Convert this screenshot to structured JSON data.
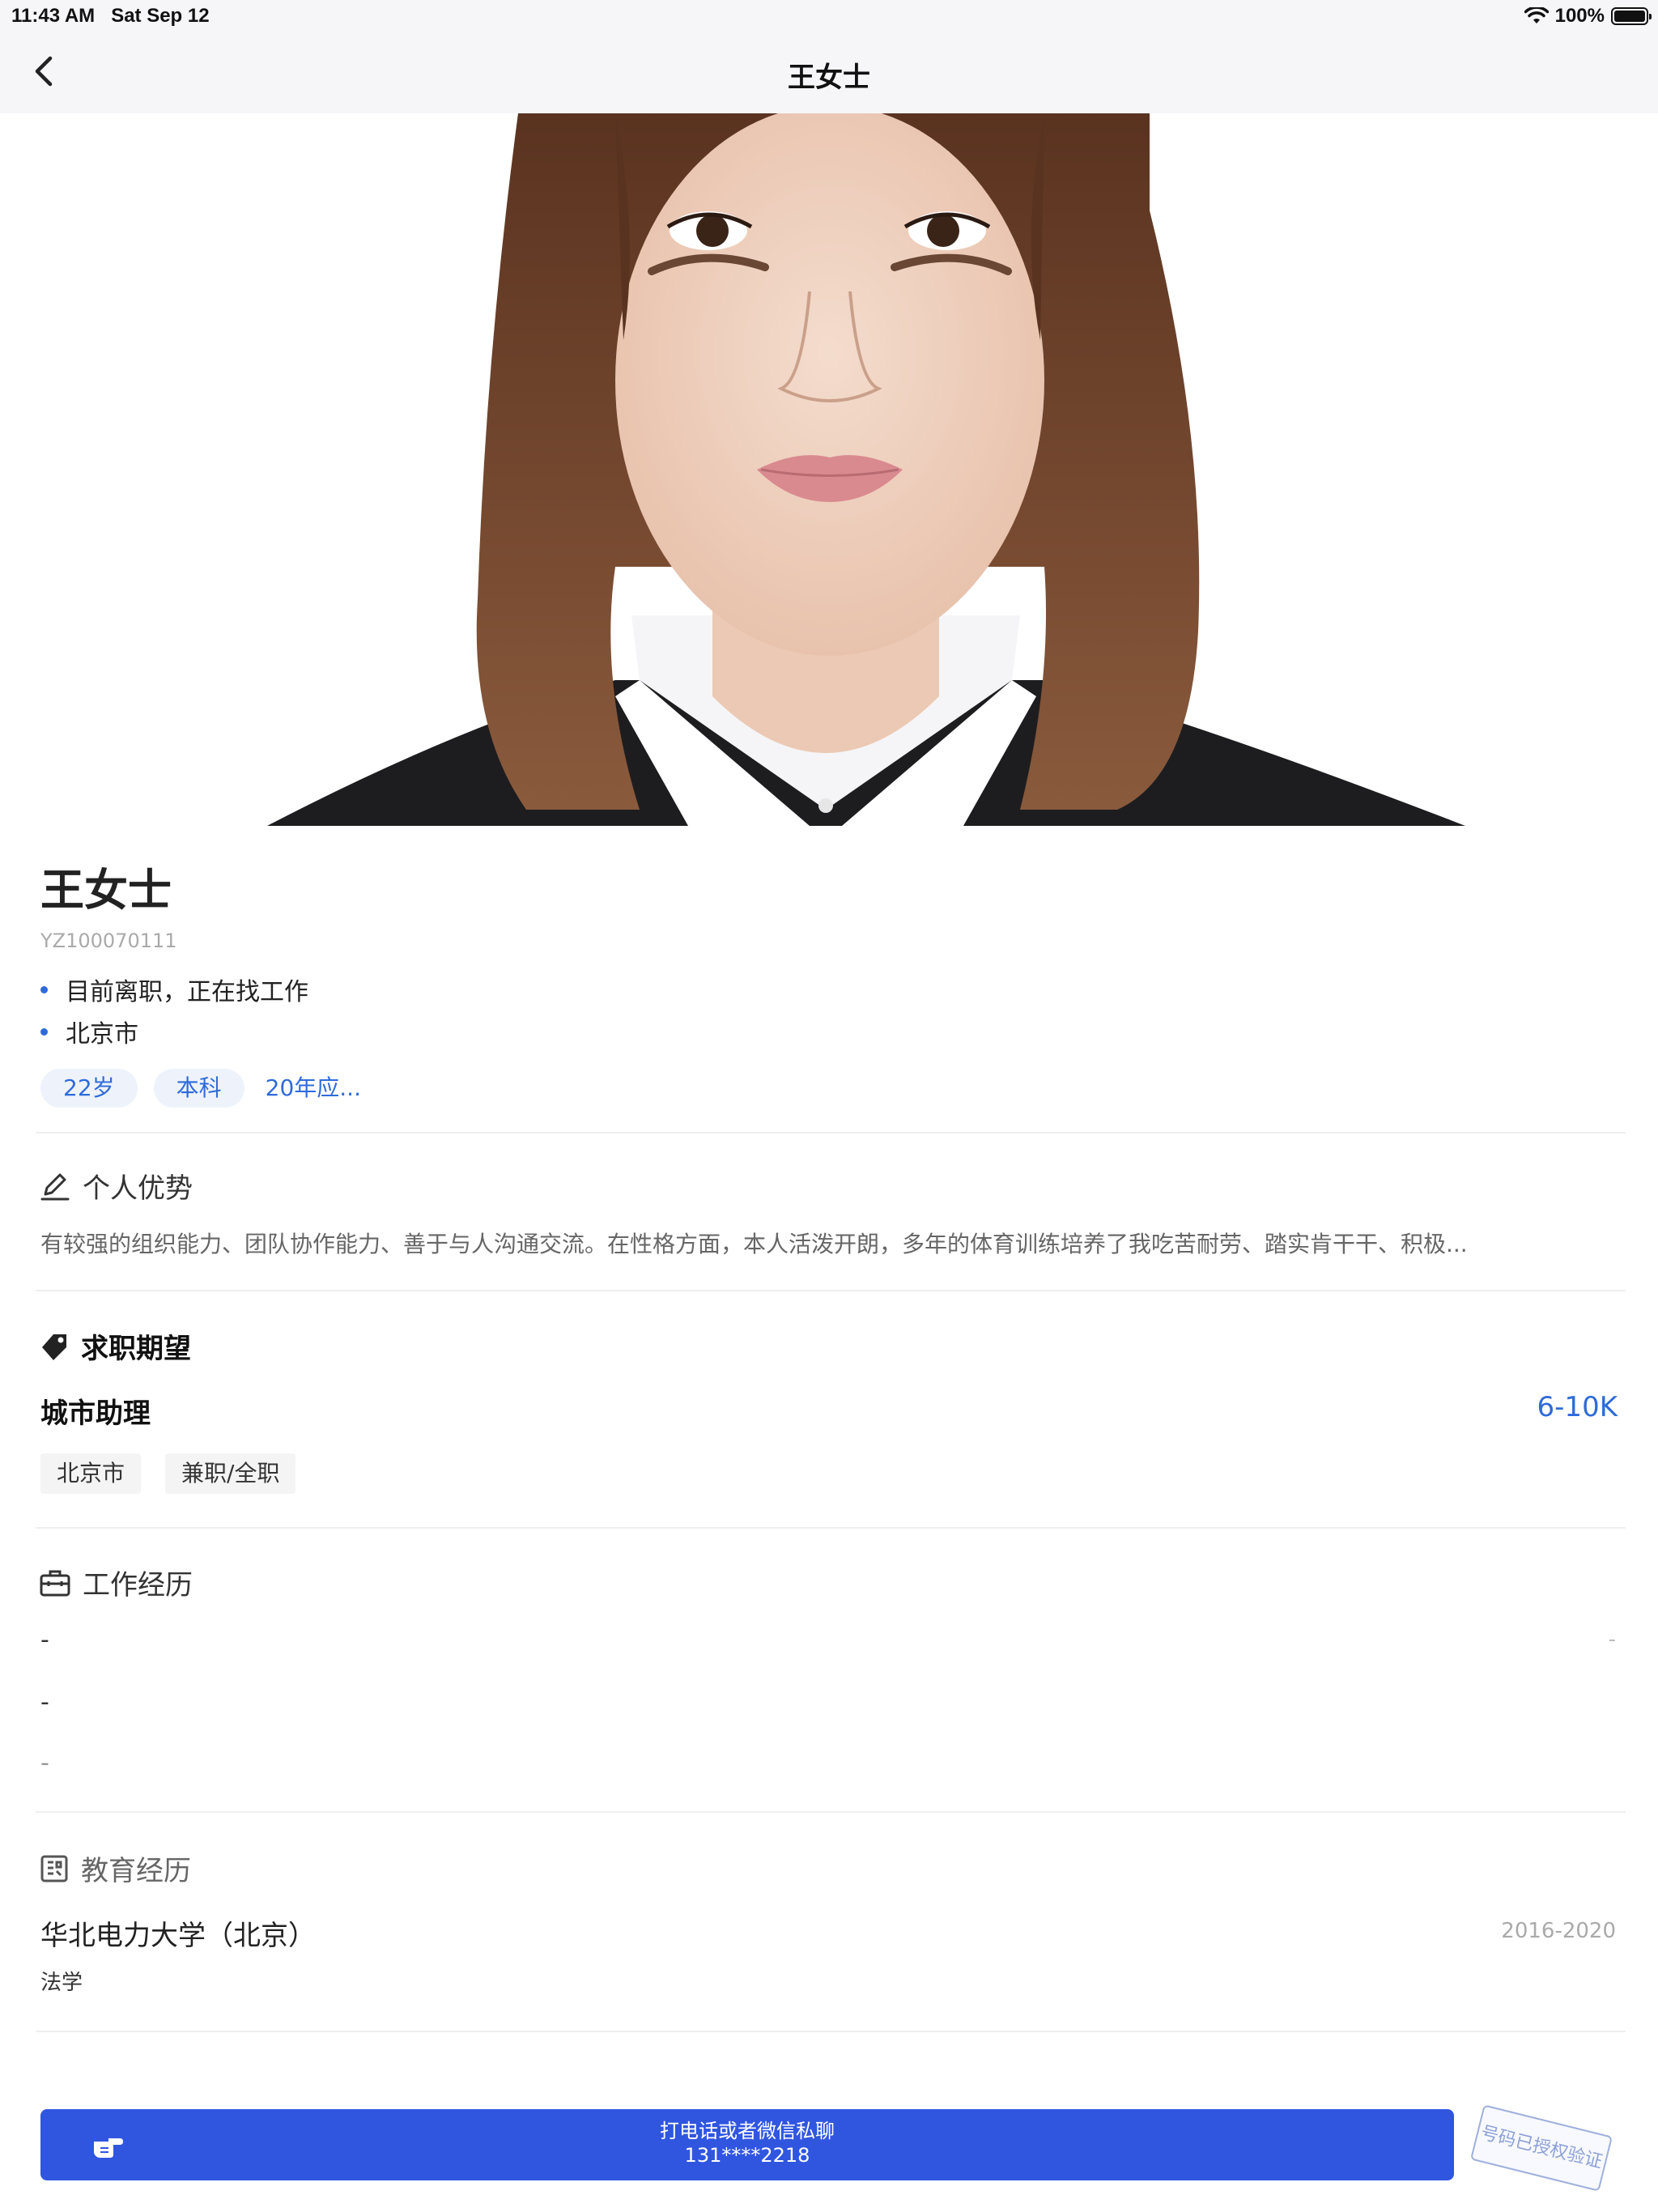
{
  "status_bar": {
    "time": "11:43 AM",
    "date": "Sat Sep 12",
    "battery_text": "100%",
    "battery_level": 1.0
  },
  "nav": {
    "title": "王女士",
    "back_icon": "chevron-left-icon"
  },
  "profile": {
    "name": "王女士",
    "id": "YZ100070111",
    "status": "目前离职，正在找工作",
    "city": "北京市",
    "tags": [
      "22岁",
      "本科",
      "20年应..."
    ],
    "accent_color": "#2f6bd8"
  },
  "advantage": {
    "title": "个人优势",
    "icon": "pencil-icon",
    "text": "有较强的组织能力、团队协作能力、善于与人沟通交流。在性格方面，本人活泼开朗，多年的体育训练培养了我吃苦耐劳、踏实肯干干、积极..."
  },
  "expectation": {
    "title": "求职期望",
    "icon": "tag-icon",
    "job": "城市助理",
    "salary": "6-10K",
    "tags": [
      "北京市",
      "兼职/全职"
    ]
  },
  "work": {
    "title": "工作经历",
    "icon": "briefcase-icon",
    "company": "-",
    "period": "-",
    "position": "-",
    "description": "-"
  },
  "education": {
    "title": "教育经历",
    "icon": "education-icon",
    "school": "华北电力大学（北京）",
    "years": "2016-2020",
    "major": "法学"
  },
  "cta": {
    "icon": "pointing-hand-icon",
    "label": "打电话或者微信私聊",
    "phone": "131****2218",
    "color": "#3056e0"
  },
  "stamp": {
    "text": "号码已授权验证"
  }
}
